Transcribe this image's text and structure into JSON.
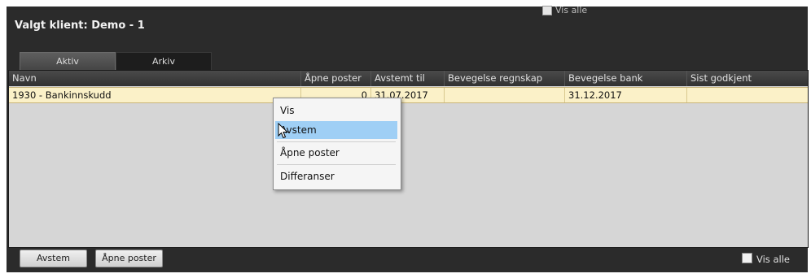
{
  "header": {
    "client_label": "Valgt klient: Demo - 1",
    "top_vis_alle": "Vis alle"
  },
  "tabs": [
    {
      "label": "Aktiv",
      "active": true
    },
    {
      "label": "Arkiv",
      "active": false
    }
  ],
  "table": {
    "columns": [
      "Navn",
      "Åpne poster",
      "Avstemt til",
      "Bevegelse regnskap",
      "Bevegelse bank",
      "Sist godkjent"
    ],
    "rows": [
      {
        "navn": "1930 - Bankinnskudd",
        "apne_poster": "0",
        "avstemt_til": "31.07.2017",
        "bevegelse_regnskap": "",
        "bevegelse_bank": "31.12.2017",
        "sist_godkjent": ""
      }
    ]
  },
  "context_menu": {
    "items": [
      "Vis",
      "Avstem",
      "Åpne poster",
      "Differanser"
    ],
    "highlighted": "Avstem"
  },
  "footer": {
    "avstem_button": "Avstem",
    "apne_poster_button": "Åpne poster",
    "vis_alle_label": "Vis alle"
  },
  "colors": {
    "background": "#2b2b2b",
    "selected_row": "#fbf1c8",
    "menu_highlight": "#9fcff5"
  }
}
